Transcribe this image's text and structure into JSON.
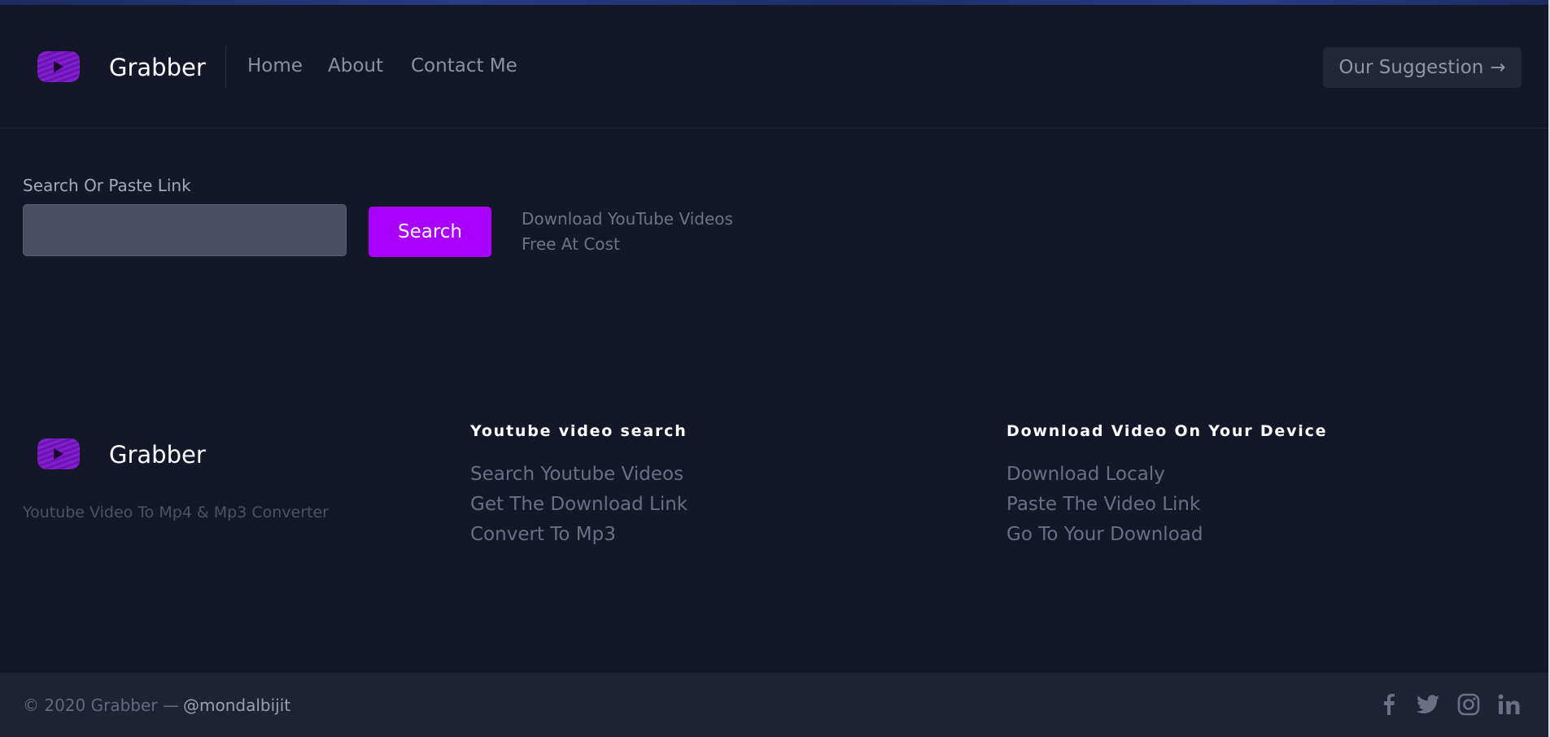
{
  "header": {
    "brand": "Grabber",
    "nav": [
      "Home",
      "About",
      "Contact Me"
    ],
    "suggestion_label": "Our Suggestion",
    "suggestion_arrow": "→"
  },
  "search": {
    "label": "Search Or Paste Link",
    "value": "",
    "placeholder": "",
    "button_label": "Search",
    "note_line1": "Download YouTube Videos",
    "note_line2": "Free At Cost"
  },
  "footer": {
    "brand": "Grabber",
    "tagline": "Youtube Video To Mp4 & Mp3 Converter",
    "col1": {
      "title": "Youtube video search",
      "links": [
        "Search Youtube Videos",
        "Get The Download Link",
        "Convert To Mp3"
      ]
    },
    "col2": {
      "title": "Download Video On Your Device",
      "links": [
        "Download Localy",
        "Paste The Video Link",
        "Go To Your Download"
      ]
    }
  },
  "bottom": {
    "copyright": "© 2020 Grabber —",
    "handle": "@mondalbijit",
    "social_icons": [
      "facebook-icon",
      "twitter-icon",
      "instagram-icon",
      "linkedin-icon"
    ]
  },
  "colors": {
    "background": "#141727",
    "accent": "#aa00ff",
    "bottom_bar": "#1e2233",
    "logo": "#7d1cc9"
  }
}
